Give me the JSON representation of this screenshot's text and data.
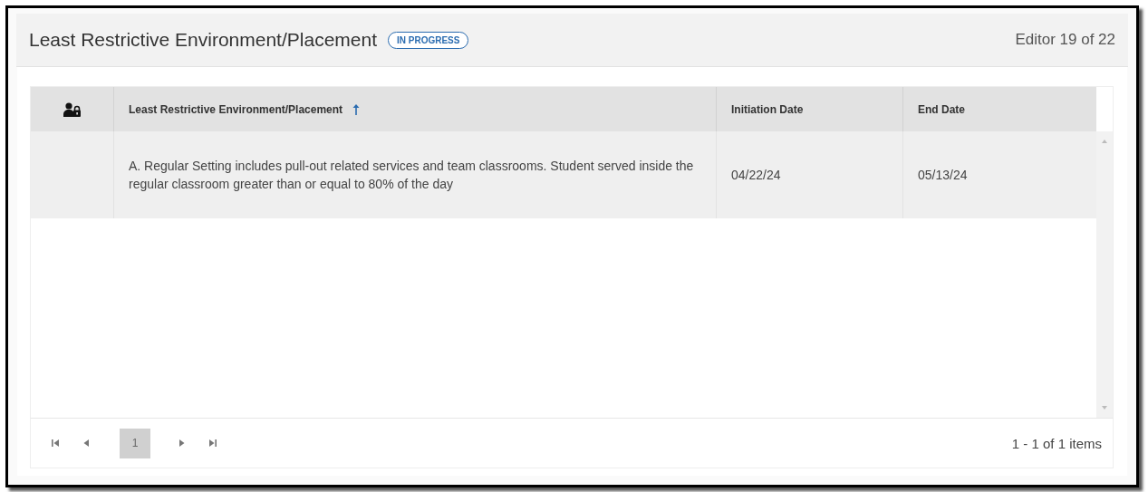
{
  "header": {
    "title": "Least Restrictive Environment/Placement",
    "status": "IN PROGRESS",
    "editor_position": "Editor 19 of 22"
  },
  "table": {
    "columns": [
      {
        "kind": "icon"
      },
      {
        "kind": "text",
        "label": "Least Restrictive Environment/Placement",
        "sorted": true
      },
      {
        "kind": "text",
        "label": "Initiation Date",
        "sorted": false
      },
      {
        "kind": "text",
        "label": "End Date",
        "sorted": false
      }
    ],
    "rows": [
      {
        "selected": true,
        "cells": [
          "",
          "A. Regular Setting includes pull-out related services and team classrooms. Student served inside the regular classroom greater than or equal to 80% of the day",
          "04/22/24",
          "05/13/24"
        ]
      }
    ]
  },
  "pager": {
    "pages": [
      {
        "label": "1",
        "selected": true
      }
    ],
    "summary": "1 - 1 of 1 items"
  }
}
